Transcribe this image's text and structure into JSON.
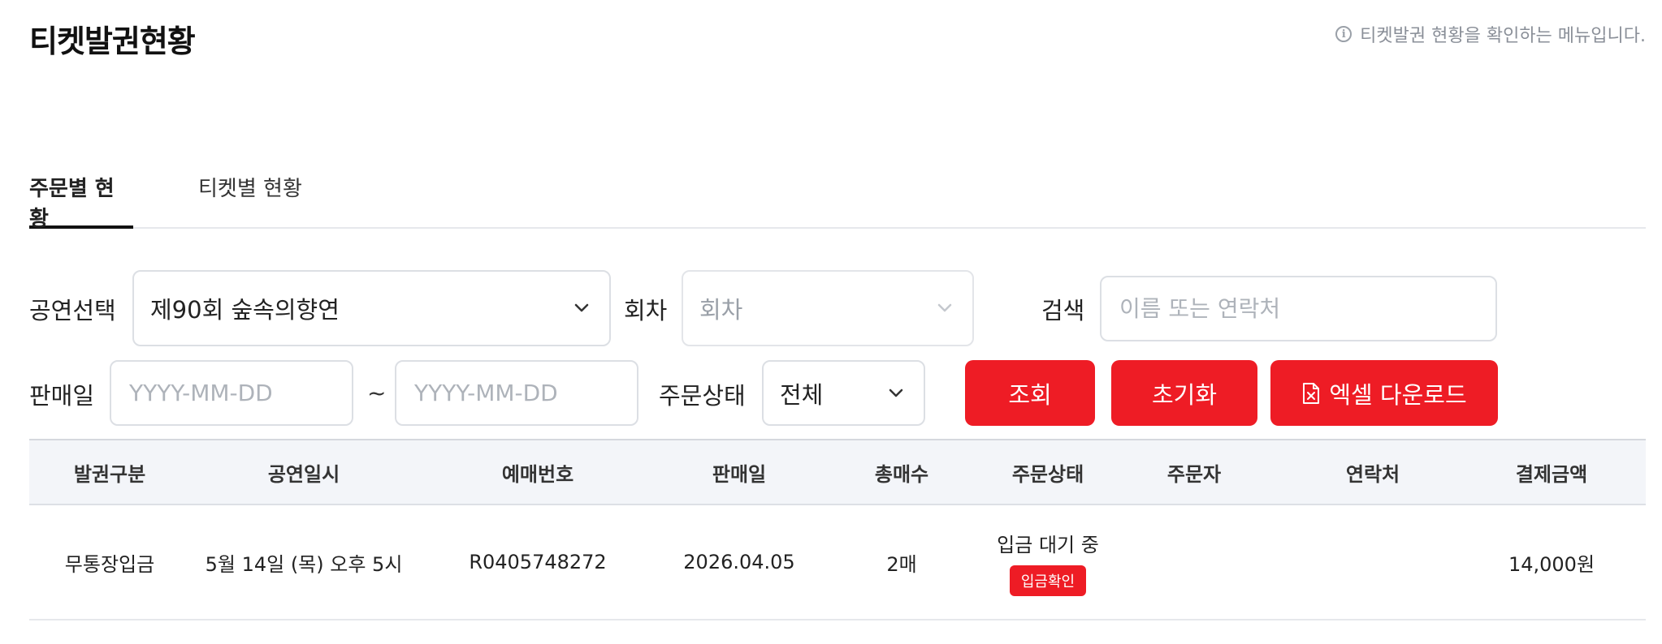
{
  "page": {
    "title": "티켓발권현황",
    "info_text": "티켓발권 현황을 확인하는 메뉴입니다."
  },
  "tabs": [
    {
      "label": "주문별 현황",
      "active": true
    },
    {
      "label": "티켓별 현황",
      "active": false
    }
  ],
  "filters": {
    "performance_label": "공연선택",
    "performance_value": "제90회 숲속의향연",
    "session_label": "회차",
    "session_value": "회차",
    "search_label": "검색",
    "search_placeholder": "이름 또는 연락처",
    "sale_date_label": "판매일",
    "date_from_placeholder": "YYYY-MM-DD",
    "date_separator": "~",
    "date_to_placeholder": "YYYY-MM-DD",
    "order_status_label": "주문상태",
    "order_status_value": "전체"
  },
  "buttons": {
    "search": "조회",
    "reset": "초기화",
    "excel": "엑셀 다운로드"
  },
  "table": {
    "headers": [
      "발권구분",
      "공연일시",
      "예매번호",
      "판매일",
      "총매수",
      "주문상태",
      "주문자",
      "연락처",
      "결제금액"
    ],
    "rows": [
      {
        "type": "무통장입금",
        "datetime": "5월 14일 (목) 오후 5시",
        "booking_no": "R0405748272",
        "sale_date": "2026.04.05",
        "qty": "2매",
        "status": "입금 대기 중",
        "status_action": "입금확인",
        "orderer": "",
        "contact": "",
        "amount": "14,000원"
      }
    ]
  },
  "colors": {
    "accent": "#ee1c25",
    "header_bg": "#f3f5f9"
  }
}
